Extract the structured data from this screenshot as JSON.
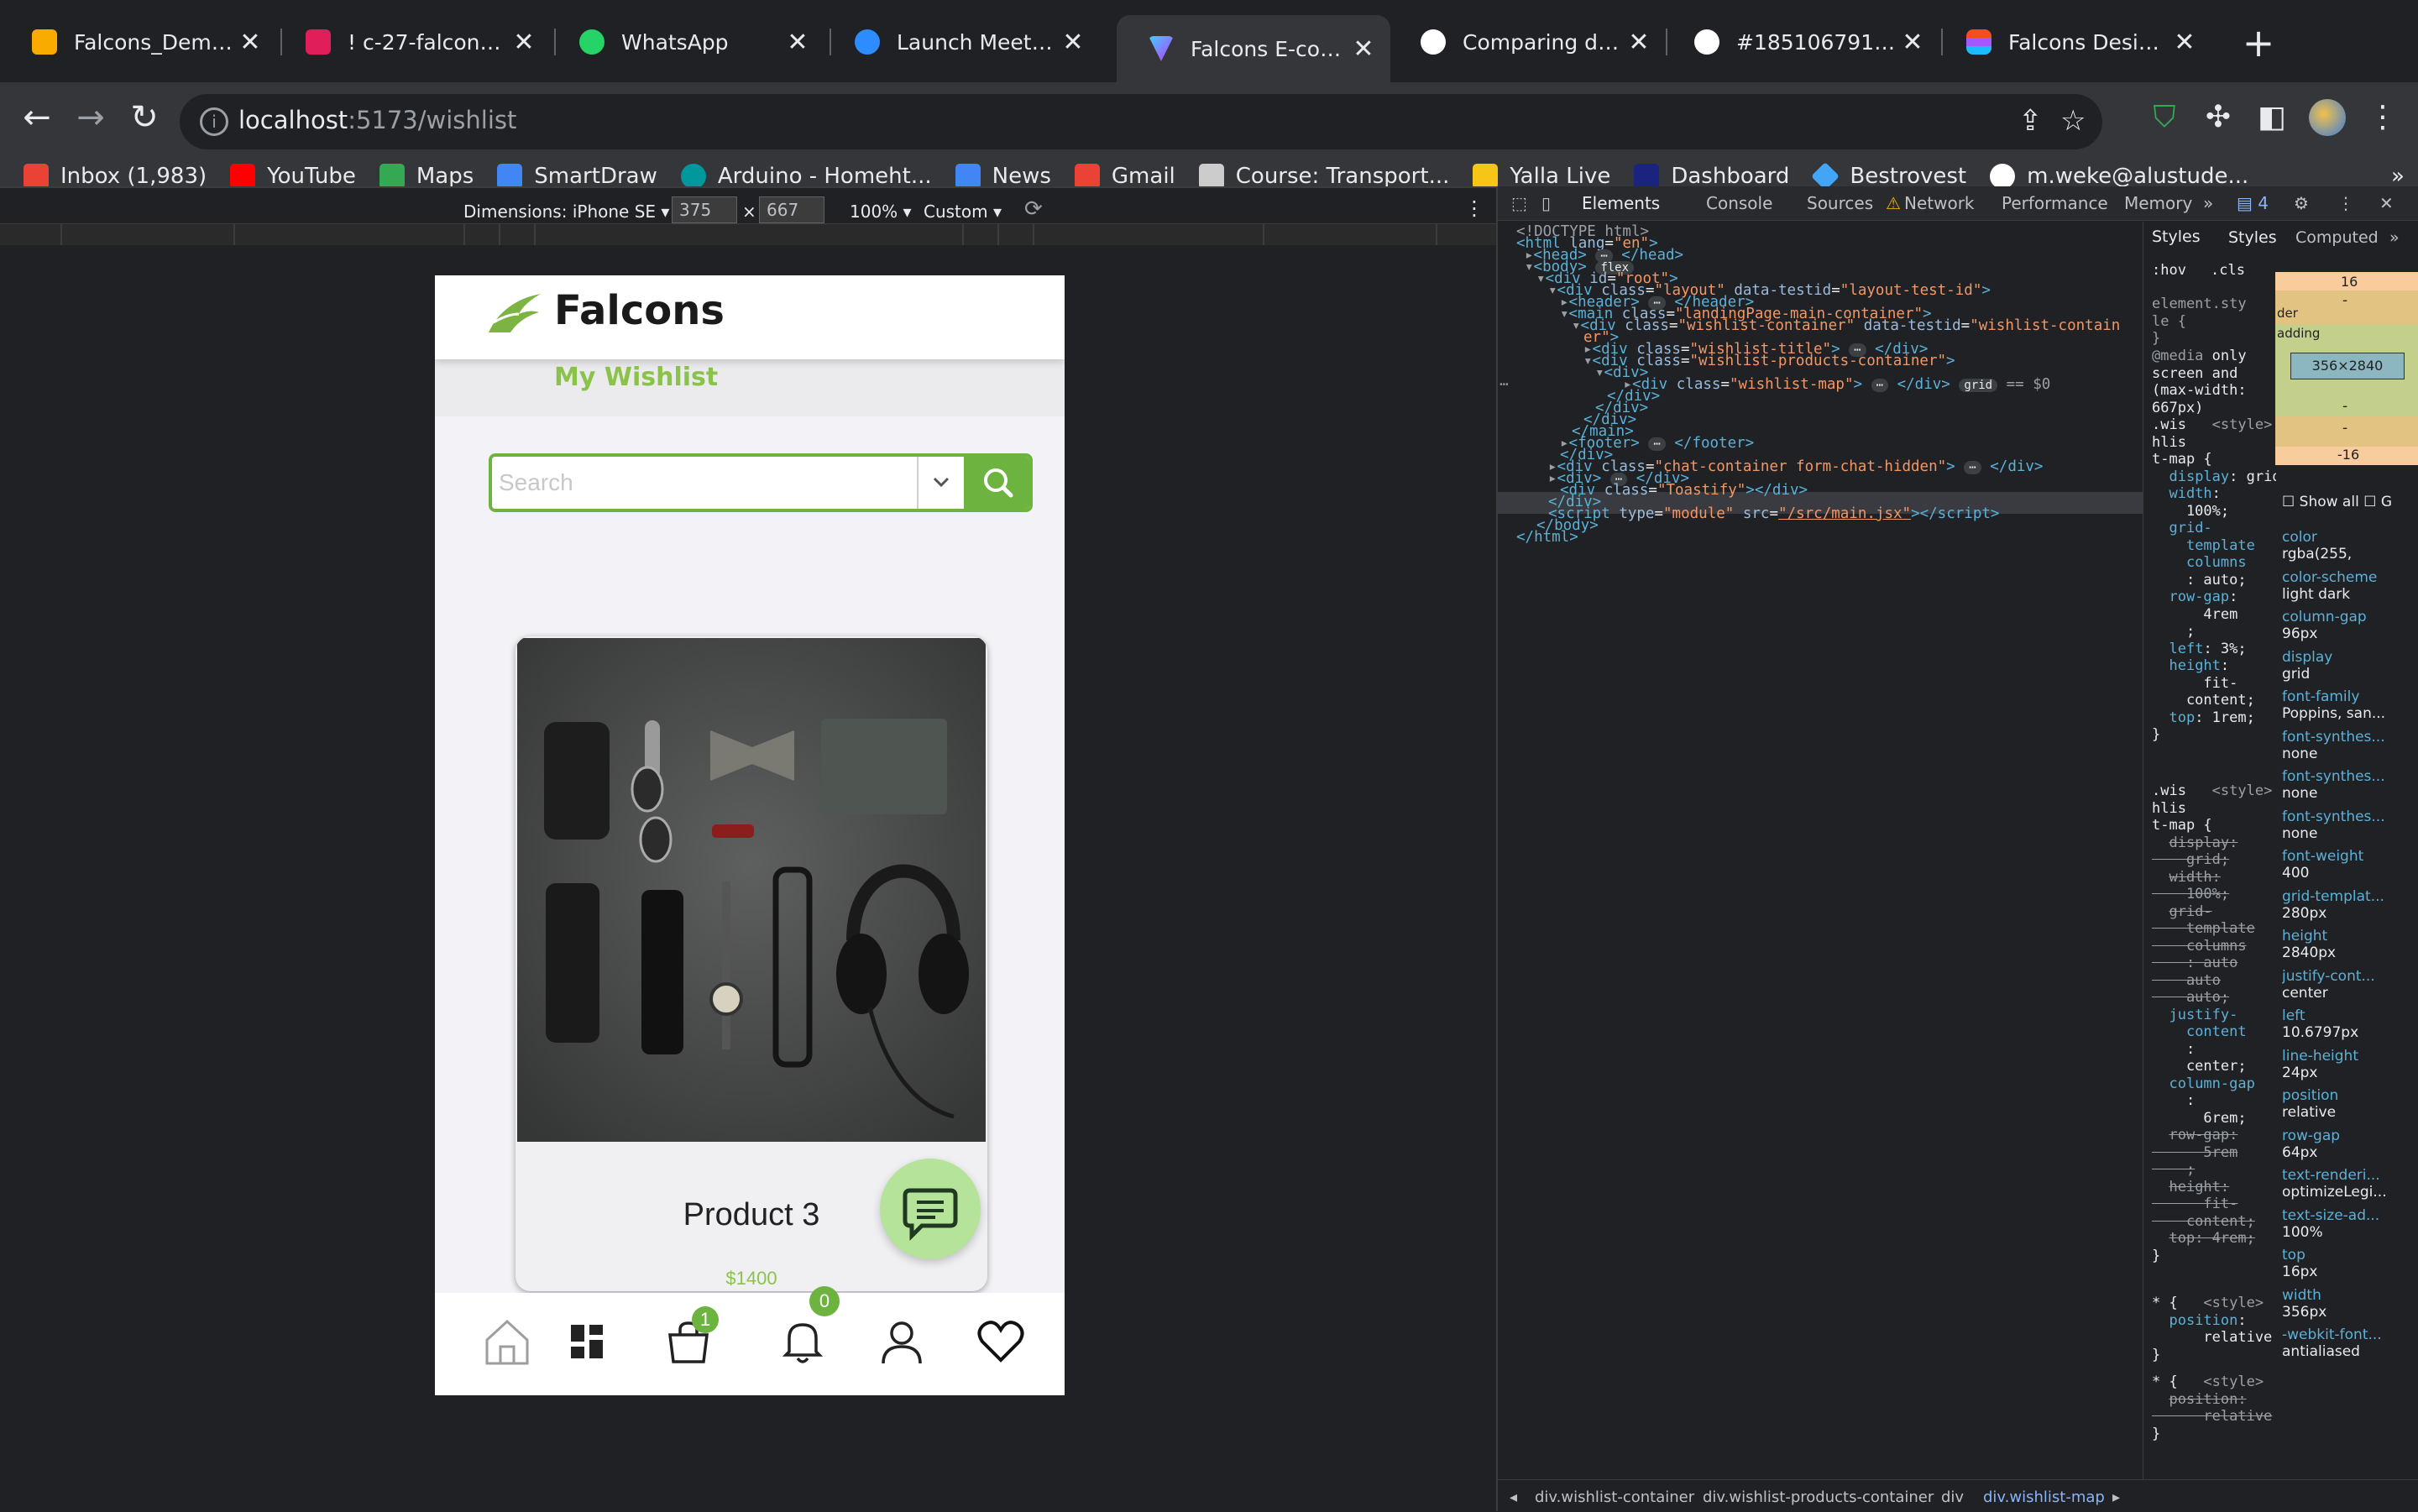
{
  "browser": {
    "tabs": [
      {
        "title": "Falcons_Demo - G",
        "favicon_color": "#f9ab00",
        "icon": "slides-icon"
      },
      {
        "title": "! c-27-falcons-de",
        "favicon_color": "#e01e5a",
        "icon": "slack-icon"
      },
      {
        "title": "WhatsApp",
        "favicon_color": "#25d366",
        "icon": "whatsapp-icon"
      },
      {
        "title": "Launch Meeting -",
        "favicon_color": "#2d8cff",
        "icon": "zoom-icon"
      },
      {
        "title": "Falcons E-comme",
        "favicon_color": "#a259ff",
        "icon": "vite-icon",
        "active": true
      },
      {
        "title": "Comparing develo",
        "favicon_color": "#ffffff",
        "icon": "github-icon"
      },
      {
        "title": "#185106791 Cart",
        "favicon_color": "#ffffff",
        "icon": "github-icon"
      },
      {
        "title": "Falcons Design -",
        "favicon_color": "#f24e1e",
        "icon": "figma-icon"
      }
    ],
    "new_tab_label": "+",
    "url_host": "localhost",
    "url_rest": ":5173/wishlist",
    "bookmarks": [
      {
        "label": "Inbox (1,983)",
        "color": "#ea4335"
      },
      {
        "label": "YouTube",
        "color": "#ff0000"
      },
      {
        "label": "Maps",
        "color": "#34a853"
      },
      {
        "label": "SmartDraw",
        "color": "#4285f4"
      },
      {
        "label": "Arduino - Homeht...",
        "color": "#00979d"
      },
      {
        "label": "News",
        "color": "#4285f4"
      },
      {
        "label": "Gmail",
        "color": "#ea4335"
      },
      {
        "label": "Course: Transport...",
        "color": "#cccccc"
      },
      {
        "label": "Yalla Live",
        "color": "#f5c518"
      },
      {
        "label": "Dashboard",
        "color": "#1a237e"
      },
      {
        "label": "Bestrovest",
        "color": "#42a5f5"
      },
      {
        "label": "m.weke@alustude...",
        "color": "#ffffff"
      }
    ],
    "more_bookmarks": "»"
  },
  "device_toolbar": {
    "dimensions_label": "Dimensions: iPhone SE ▾",
    "width": "375",
    "times": "×",
    "height": "667",
    "zoom": "100% ▾",
    "throttle": "Custom ▾"
  },
  "app": {
    "brand": "Falcons",
    "wishlist_title": "My Wishlist",
    "search_placeholder": "Search",
    "product": {
      "name": "Product 3",
      "price": "$1400"
    },
    "cart_count": "1",
    "notification_count": "0",
    "accent_color": "#6db33f"
  },
  "devtools": {
    "tabs": [
      "Elements",
      "Console",
      "Sources",
      "Network",
      "Performance",
      "Memory"
    ],
    "more_tabs": "»",
    "issue_count": "4",
    "styles_tabs": [
      "Styles",
      "Computed"
    ],
    "hov": ":hov",
    "cls": ".cls",
    "breadcrumbs": [
      "div.wishlist-container",
      "div.wishlist-products-container",
      "div",
      "div.wishlist-map"
    ],
    "box_model": {
      "margin_top": "16",
      "margin_bottom": "-16",
      "content": "356×2840",
      "border": "der",
      "padding": "adding",
      "dash": "-"
    },
    "show_all": "Show all",
    "show_all_extra": "G",
    "computed": [
      {
        "name": "color",
        "value": "rgba(255,"
      },
      {
        "name": "color-scheme",
        "value": "light dark"
      },
      {
        "name": "column-gap",
        "value": "96px"
      },
      {
        "name": "display",
        "value": "grid"
      },
      {
        "name": "font-family",
        "value": "Poppins, san..."
      },
      {
        "name": "font-synthes...",
        "value": "none"
      },
      {
        "name": "font-synthes...",
        "value": "none"
      },
      {
        "name": "font-synthes...",
        "value": "none"
      },
      {
        "name": "font-weight",
        "value": "400"
      },
      {
        "name": "grid-templat...",
        "value": "280px"
      },
      {
        "name": "height",
        "value": "2840px"
      },
      {
        "name": "justify-cont...",
        "value": "center"
      },
      {
        "name": "left",
        "value": "10.6797px"
      },
      {
        "name": "line-height",
        "value": "24px"
      },
      {
        "name": "position",
        "value": "relative"
      },
      {
        "name": "row-gap",
        "value": "64px"
      },
      {
        "name": "text-renderi...",
        "value": "optimizeLegi..."
      },
      {
        "name": "text-size-ad...",
        "value": "100%"
      },
      {
        "name": "top",
        "value": "16px"
      },
      {
        "name": "width",
        "value": "356px"
      },
      {
        "name": "-webkit-font...",
        "value": "antialiased"
      }
    ]
  }
}
